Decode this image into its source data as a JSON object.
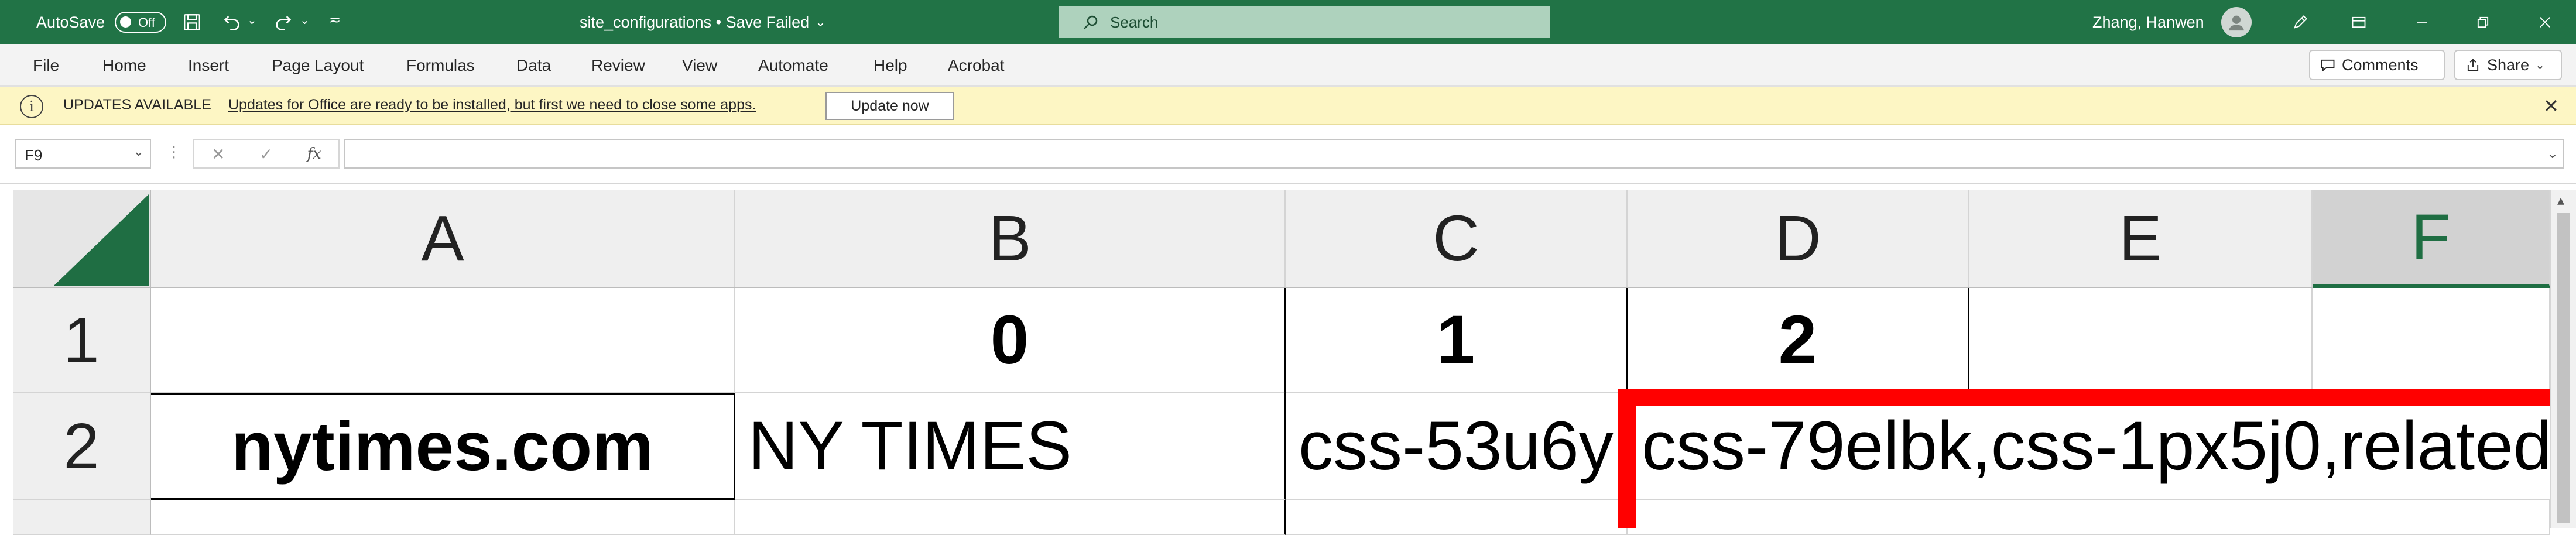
{
  "titlebar": {
    "autosave_label": "AutoSave",
    "autosave_state": "Off",
    "file_title": "site_configurations • Save Failed",
    "search_placeholder": "Search",
    "user_name": "Zhang, Hanwen",
    "bg_color": "#217346"
  },
  "menu": {
    "items": [
      "File",
      "Home",
      "Insert",
      "Page Layout",
      "Formulas",
      "Data",
      "Review",
      "View",
      "Automate",
      "Help",
      "Acrobat"
    ],
    "comments_label": "Comments",
    "share_label": "Share"
  },
  "update_bar": {
    "title": "UPDATES AVAILABLE",
    "message": "Updates for Office are ready to be installed, but first we need to close some apps.",
    "button_label": "Update now"
  },
  "formula_bar": {
    "name_box": "F9",
    "cancel_icon": "✕",
    "enter_icon": "✓",
    "fx_label": "fx",
    "formula": ""
  },
  "grid": {
    "columns": [
      "A",
      "B",
      "C",
      "D",
      "E",
      "F"
    ],
    "selected_column": "F",
    "rows": [
      "1",
      "2"
    ],
    "cells": {
      "A1": "",
      "B1": "0",
      "C1": "1",
      "D1": "2",
      "E1": "",
      "F1": "",
      "A2": "nytimes.com",
      "B2": "NY TIMES",
      "C2": "css-53u6y",
      "D2": "css-79elbk,css-1px5j0,related"
    },
    "accent_color": "#1f6e43",
    "highlight_color": "#ff0000"
  }
}
